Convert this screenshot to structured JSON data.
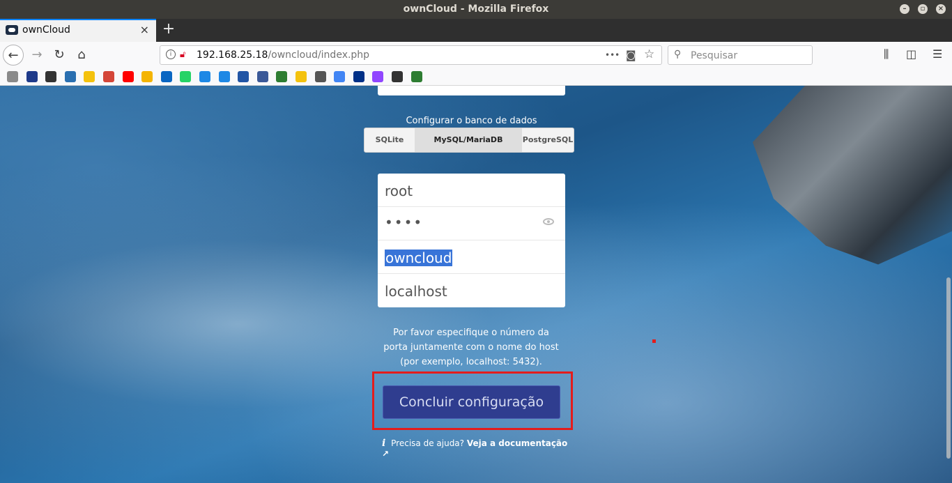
{
  "window": {
    "title": "ownCloud - Mozilla Firefox"
  },
  "tab": {
    "label": "ownCloud",
    "close_glyph": "×",
    "new_tab_glyph": "+"
  },
  "nav": {
    "back_glyph": "←",
    "forward_glyph": "→",
    "reload_glyph": "↻",
    "home_glyph": "⌂",
    "url_host": "192.168.25.18",
    "url_path": "/owncloud/index.php",
    "page_actions_glyph": "•••",
    "bookmark_glyph": "☆"
  },
  "search": {
    "placeholder": "Pesquisar"
  },
  "bookmarks": {
    "colors": [
      "#8a8a8a",
      "#1e3a8a",
      "#333333",
      "#2a6fb0",
      "#f4c20d",
      "#d44638",
      "#ff0000",
      "#f4b400",
      "#0a66c2",
      "#25d366",
      "#1e88e5",
      "#1e88e5",
      "#2155a5",
      "#3b5998",
      "#2e7d32",
      "#f4c20d",
      "#555555",
      "#4285f4",
      "#003087",
      "#9146ff",
      "#333333",
      "#2e7d32"
    ]
  },
  "setup": {
    "db_label": "Configurar o banco de dados",
    "db_tabs": [
      {
        "label": "SQLite",
        "active": false
      },
      {
        "label": "MySQL/MariaDB",
        "active": true
      },
      {
        "label": "PostgreSQL",
        "active": false
      }
    ],
    "db_user": "root",
    "db_password_masked": "••••",
    "db_name": "owncloud",
    "db_host": "localhost",
    "hint": "Por favor especifique o número da porta juntamente com o nome do host (por exemplo, localhost: 5432).",
    "submit_label": "Concluir configuração",
    "help_text": "Precisa de ajuda?",
    "help_link": "Veja a documentação ↗"
  }
}
